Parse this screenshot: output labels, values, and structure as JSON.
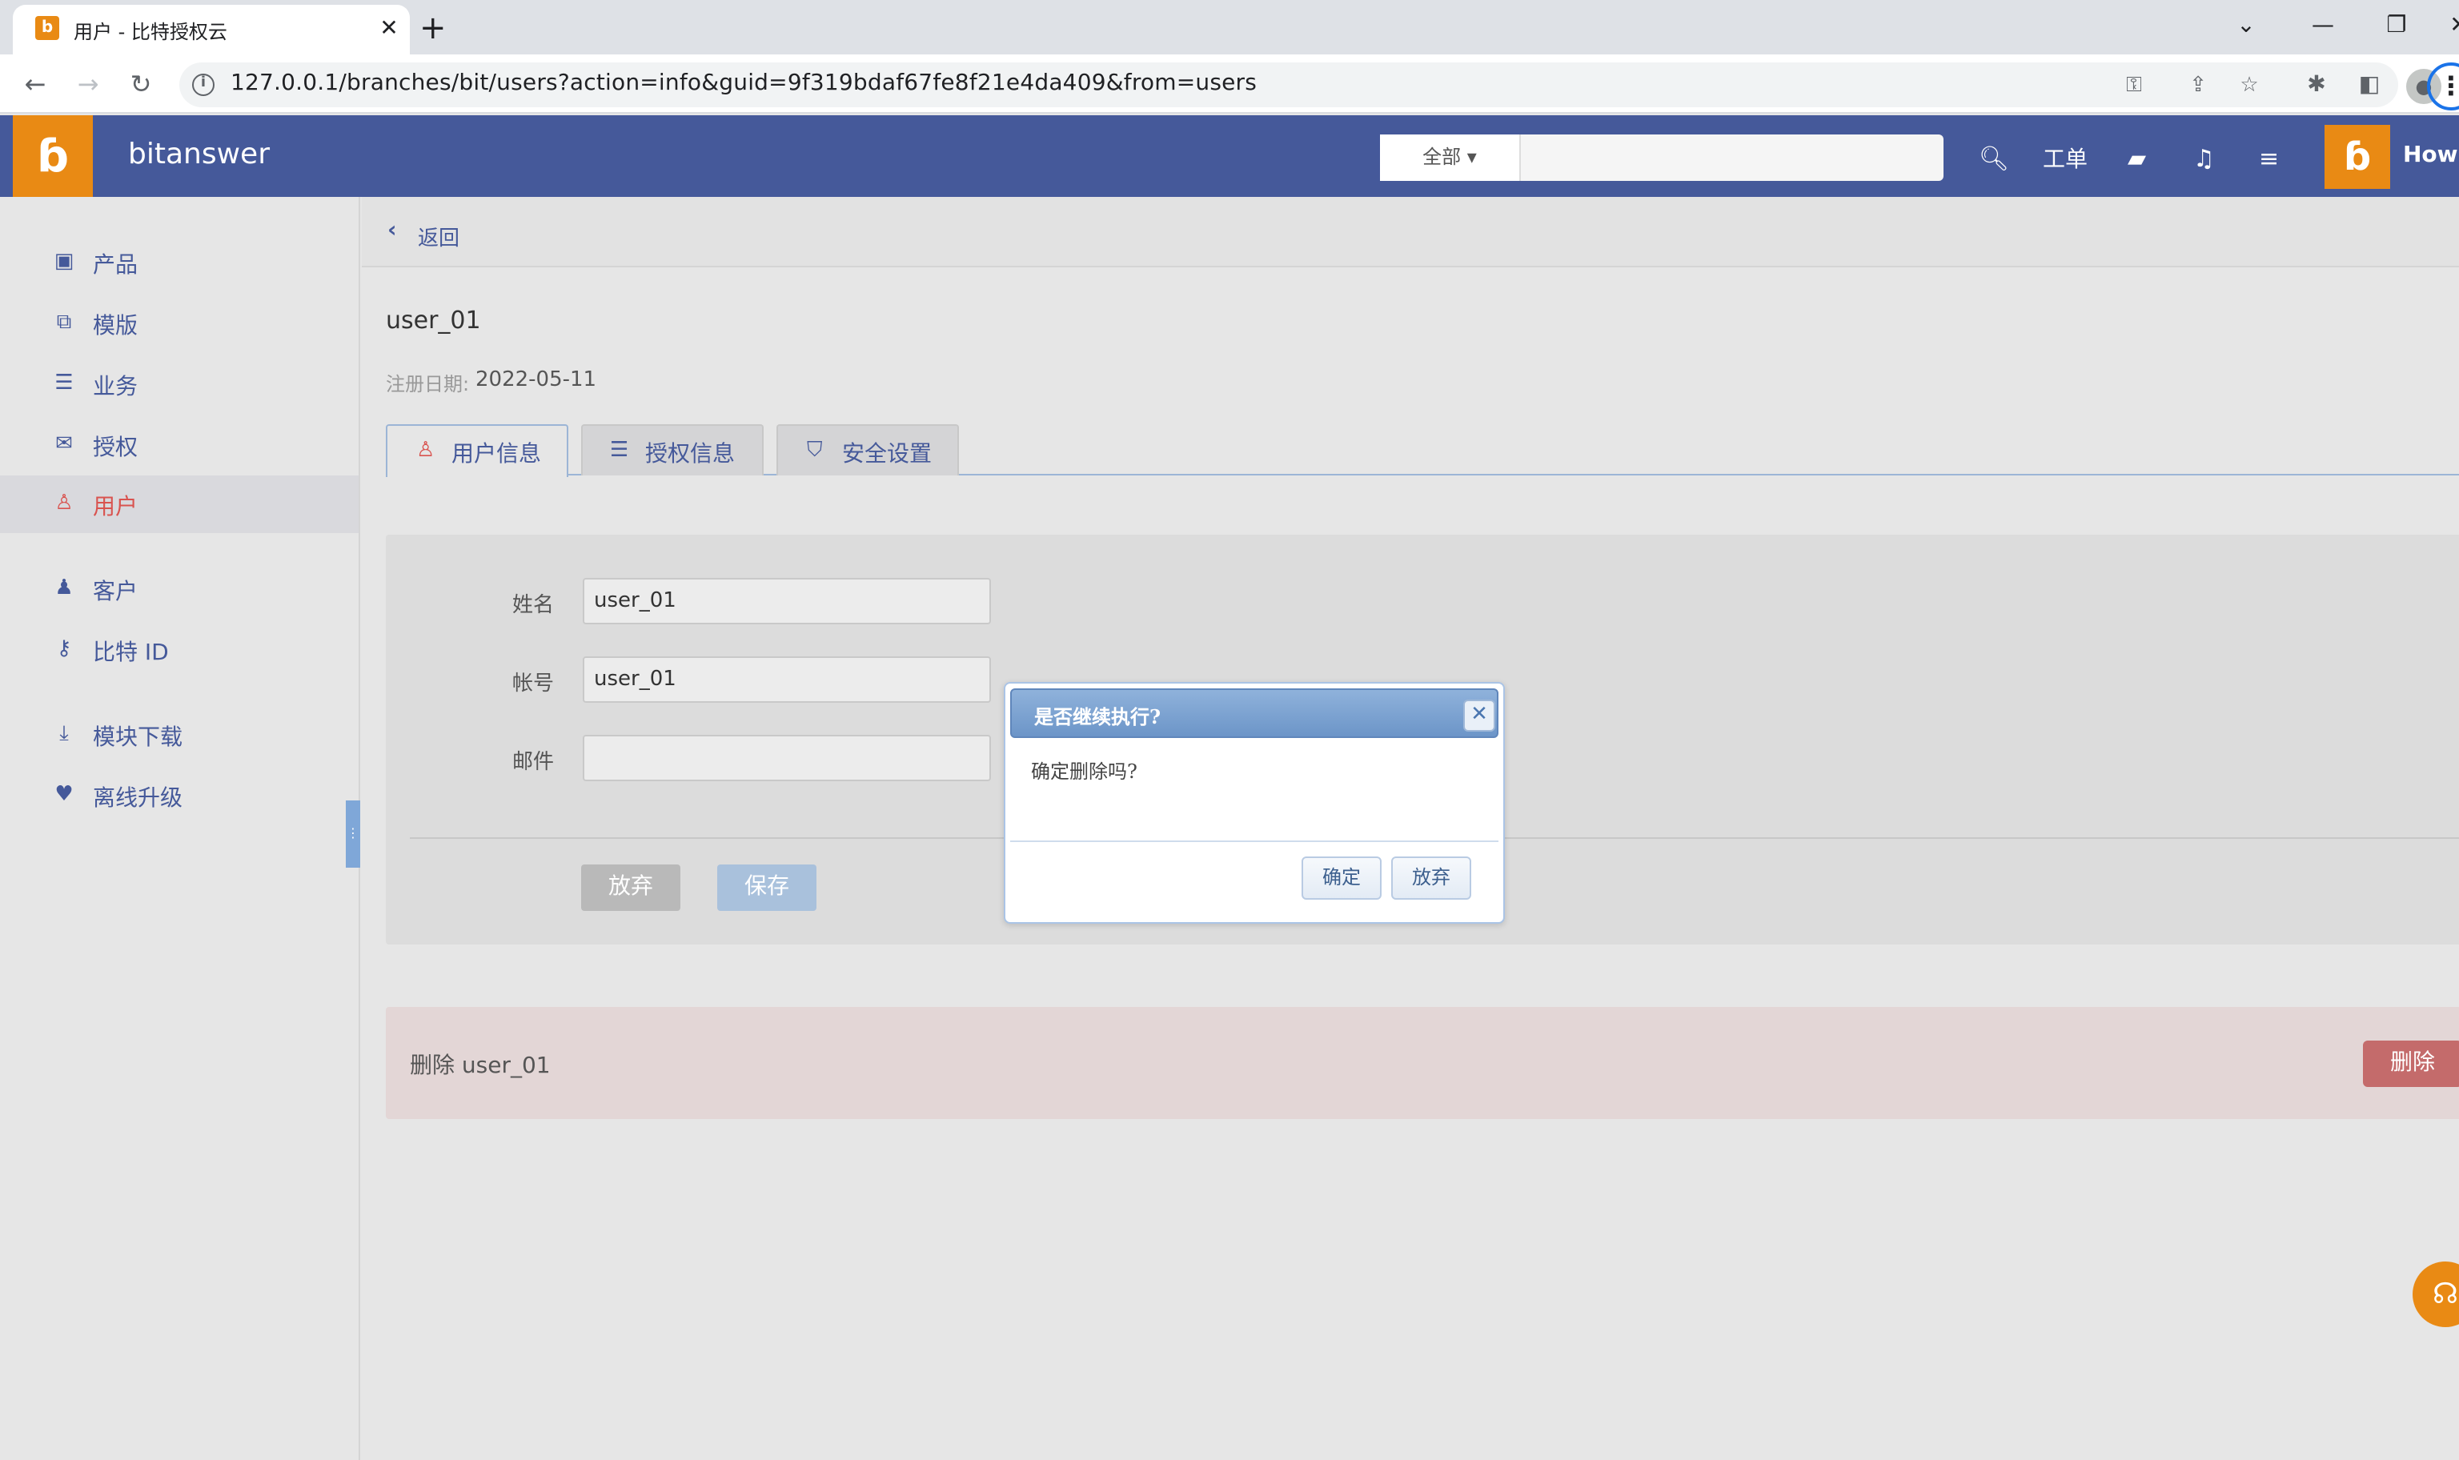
{
  "browser": {
    "tab_title": "用户 - 比特授权云",
    "tab_favicon": "b",
    "new_tab": "+",
    "url": "127.0.0.1/branches/bit/users?action=info&guid=9f319bdaf67fe8f21e4da409&from=users"
  },
  "header": {
    "brand": "bitanswer",
    "search_scope": "全部",
    "search_placeholder": "",
    "ticket_label": "工单",
    "user_name": "Howie",
    "colors": {
      "bar": "#45599a",
      "accent": "#e98a14"
    }
  },
  "sidebar": {
    "items": [
      {
        "label": "产品",
        "icon": "briefcase-icon"
      },
      {
        "label": "模版",
        "icon": "template-icon"
      },
      {
        "label": "业务",
        "icon": "sliders-icon"
      },
      {
        "label": "授权",
        "icon": "envelope-icon"
      },
      {
        "label": "用户",
        "icon": "user-outline-icon",
        "active": true
      },
      {
        "label": "客户",
        "icon": "user-icon"
      },
      {
        "label": "比特 ID",
        "icon": "key-icon"
      },
      {
        "label": "模块下载",
        "icon": "download-icon"
      },
      {
        "label": "离线升级",
        "icon": "heartbeat-icon"
      }
    ]
  },
  "main": {
    "back_label": "返回",
    "user_title": "user_01",
    "reg_label": "注册日期:",
    "reg_date": "2022-05-11",
    "tabs": [
      {
        "label": "用户信息",
        "active": true
      },
      {
        "label": "授权信息"
      },
      {
        "label": "安全设置"
      }
    ],
    "form": {
      "name_label": "姓名",
      "name_value": "user_01",
      "account_label": "帐号",
      "account_value": "user_01",
      "email_label": "邮件",
      "email_value": "",
      "discard_label": "放弃",
      "save_label": "保存"
    },
    "danger": {
      "text": "删除 user_01",
      "delete_label": "删除"
    }
  },
  "dialog": {
    "title": "是否继续执行?",
    "message": "确定删除吗?",
    "confirm_label": "确定",
    "cancel_label": "放弃"
  }
}
